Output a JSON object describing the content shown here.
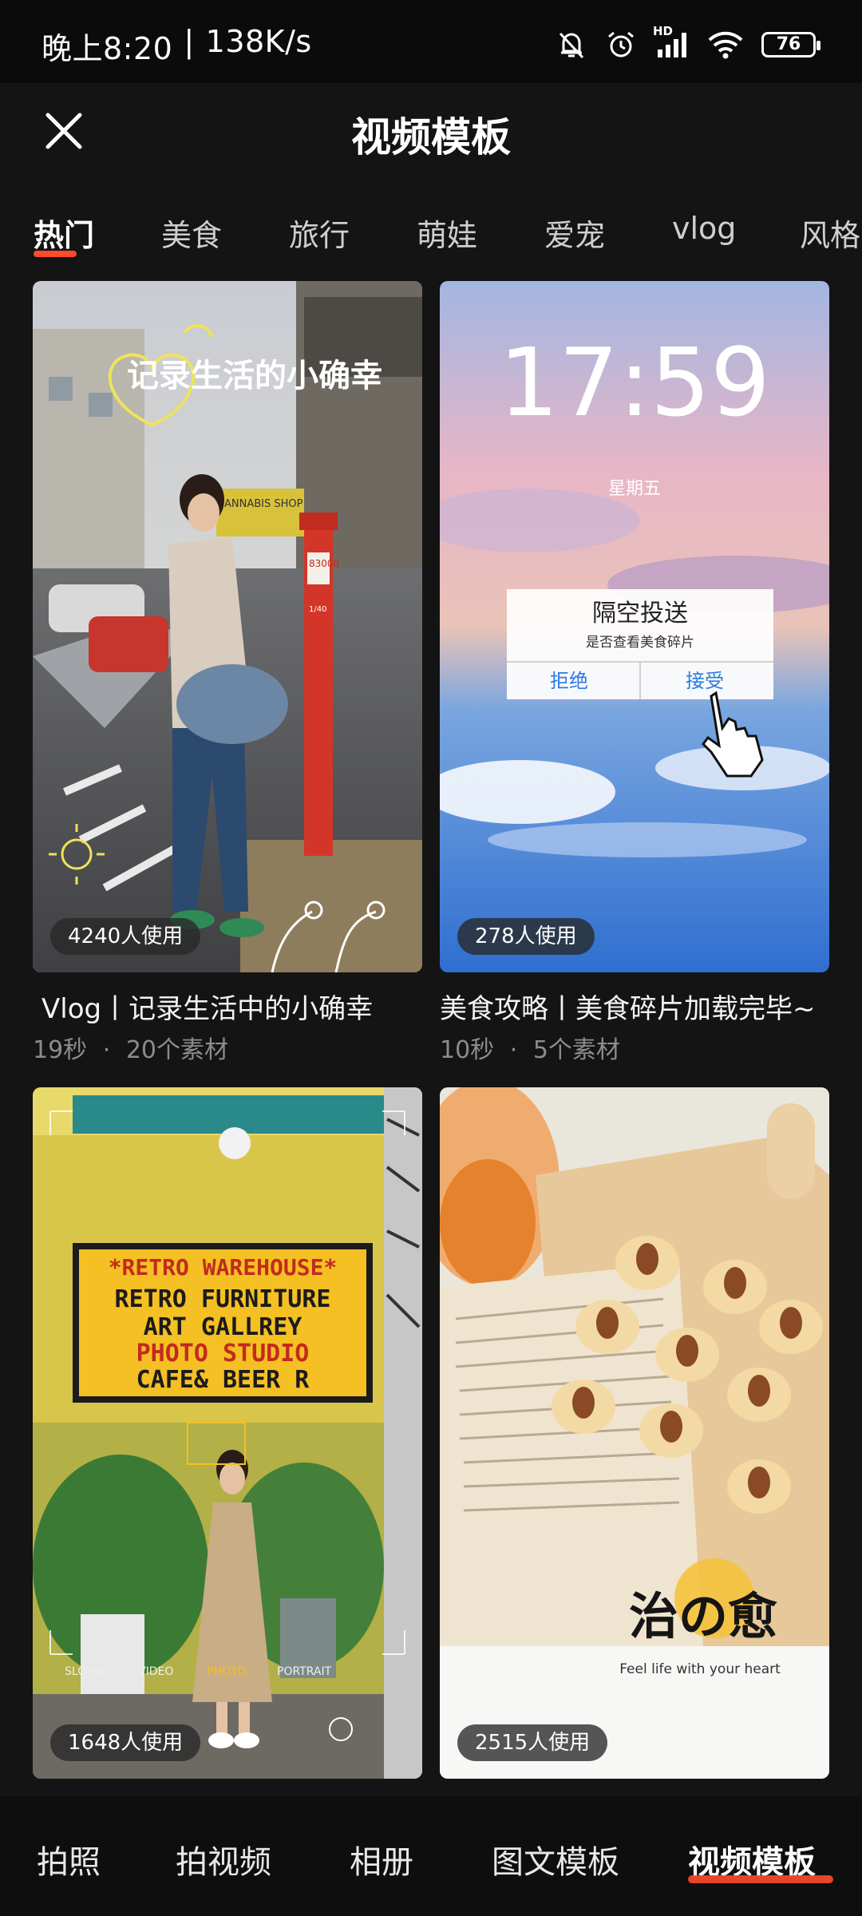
{
  "status_bar": {
    "time": "晚上8:20",
    "network_speed": "138K/s",
    "network_separator": "|",
    "hd_label": "HD",
    "battery": "76"
  },
  "header": {
    "title": "视频模板",
    "close_icon": "close-icon"
  },
  "tabs": [
    "热门",
    "美食",
    "旅行",
    "萌娃",
    "爱宠",
    "vlog",
    "风格"
  ],
  "templates": [
    {
      "title": "Vlog丨记录生活中的小确幸",
      "duration": "19秒",
      "separator": "·",
      "materials": "20个素材",
      "usage": "4240人使用",
      "overlay_text": "记录生活的小确幸",
      "sign_text": "ANNABIS SHOP",
      "mailbox_code": "83000",
      "mailbox_fraction": "1/40"
    },
    {
      "title": "美食攻略丨美食碎片加载完毕~",
      "duration": "10秒",
      "separator": "·",
      "materials": "5个素材",
      "usage": "278人使用",
      "clock": "17:59",
      "weekday": "星期五",
      "dialog_title": "隔空投送",
      "dialog_sub": "是否查看美食碎片",
      "dialog_reject": "拒绝",
      "dialog_accept": "接受"
    },
    {
      "usage": "1648人使用",
      "sign_lines": [
        "*RETRO WAREHOUSE*",
        "RETRO FURNITURE",
        "ART GALLREY",
        "PHOTO STUDIO",
        "CAFE& BEER R"
      ],
      "camera_modes": [
        "SLO-MO",
        "VIDEO",
        "PHOTO",
        "PORTRAIT"
      ]
    },
    {
      "usage": "2515人使用",
      "logo_text": "治の愈",
      "tagline": "Feel life with your heart"
    }
  ],
  "bottom_nav": [
    "拍照",
    "拍视频",
    "相册",
    "图文模板",
    "视频模板"
  ],
  "colors": {
    "accent": "#ff4a2b",
    "background": "#141414",
    "meta_text": "#8c8c8c"
  }
}
